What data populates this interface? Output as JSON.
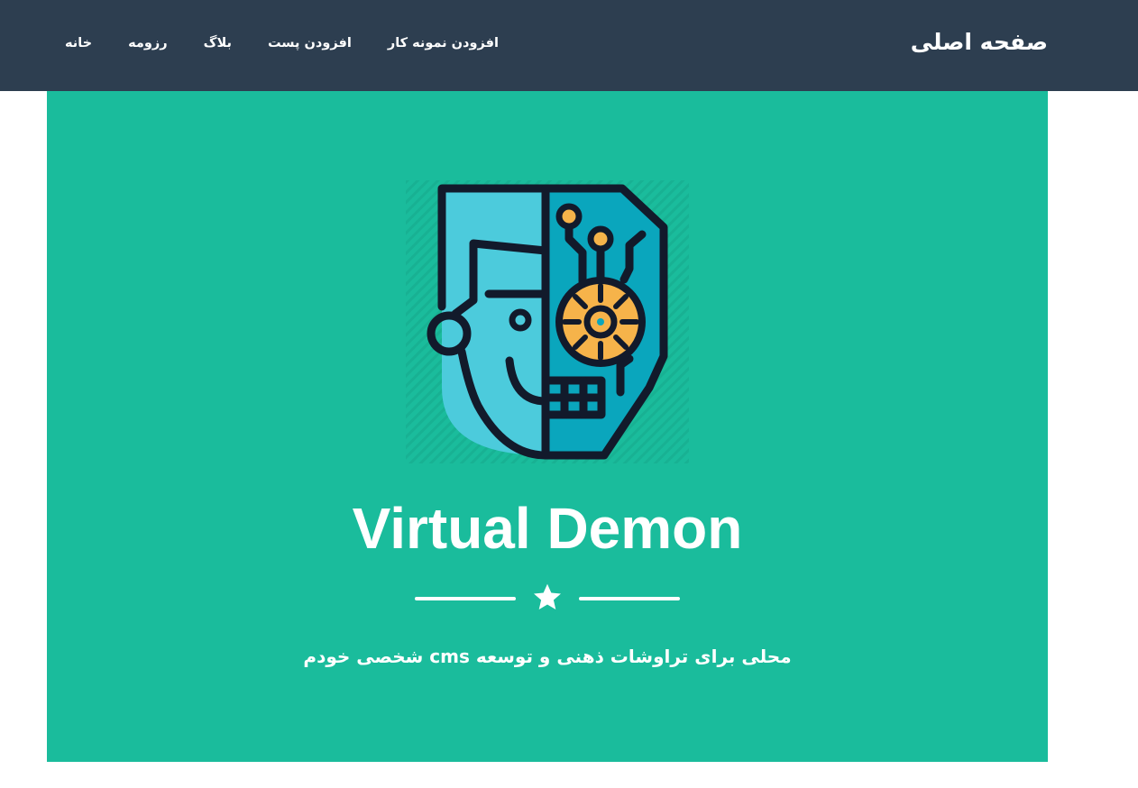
{
  "navbar": {
    "brand": "صفحه اصلی",
    "items": [
      {
        "label": "خانه"
      },
      {
        "label": "رزومه"
      },
      {
        "label": "بلاگ"
      },
      {
        "label": "افزودن پست"
      },
      {
        "label": "افزودن نمونه کار"
      }
    ]
  },
  "masthead": {
    "avatar_icon": "robot-human-face-icon",
    "title": "Virtual Demon",
    "divider_icon": "star-icon",
    "tagline": "محلی برای تراوشات ذهنی و توسعه cms شخصی خودم"
  },
  "colors": {
    "navbar_bg": "#2d3e50",
    "masthead_bg": "#1abc9c",
    "face_light": "#4ccbdc",
    "face_dark": "#0aa6bd",
    "gear": "#f6b34a",
    "outline": "#121a2b",
    "text": "#ffffff"
  }
}
